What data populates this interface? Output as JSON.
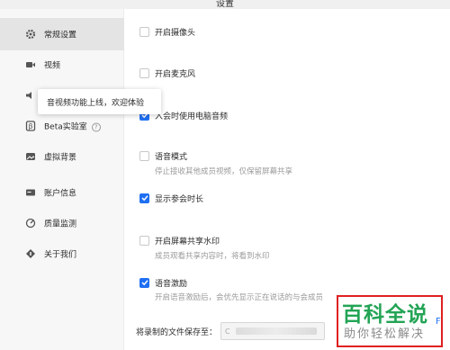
{
  "window": {
    "title": "设置"
  },
  "sidebar": {
    "items": [
      {
        "label": "常规设置",
        "icon": "gear-icon",
        "active": true
      },
      {
        "label": "视频",
        "icon": "video-camera-icon"
      },
      {
        "label": "音频",
        "icon": "speaker-icon"
      },
      {
        "label": "Beta实验室",
        "icon": "beta-icon",
        "help": "?"
      },
      {
        "label": "虚拟背景",
        "icon": "image-icon"
      },
      {
        "label": "账户信息",
        "icon": "account-icon"
      },
      {
        "label": "质量监测",
        "icon": "monitor-icon"
      },
      {
        "label": "关于我们",
        "icon": "info-icon"
      }
    ]
  },
  "tooltip": {
    "text": "音视频功能上线，欢迎体验"
  },
  "options": [
    {
      "label": "开启摄像头",
      "checked": false
    },
    {
      "label": "开启麦克风",
      "checked": false
    },
    {
      "label": "入会时使用电脑音频",
      "checked": true
    },
    {
      "label": "语音模式",
      "checked": false,
      "desc": "停止接收其他成员视频，仅保留屏幕共享"
    },
    {
      "label": "显示参会时长",
      "checked": true
    },
    {
      "label": "开启屏幕共享水印",
      "checked": false,
      "desc": "成员观看共享内容时，将看到水印"
    },
    {
      "label": "语音激励",
      "checked": true,
      "desc": "开启语音激励后，会优先显示正在说话的与会成员"
    }
  ],
  "recording": {
    "label": "将录制的文件保存至：",
    "path_prefix": "C"
  },
  "watermark": {
    "title": "百科全说",
    "subtitle": "助你轻松解决",
    "edge_char": "F"
  },
  "colors": {
    "accent": "#1f6ff2",
    "sidebar_bg": "#f7f7f7",
    "active_bg": "#e4e4e4",
    "watermark_green": "#23a455",
    "watermark_red": "#e02020"
  }
}
